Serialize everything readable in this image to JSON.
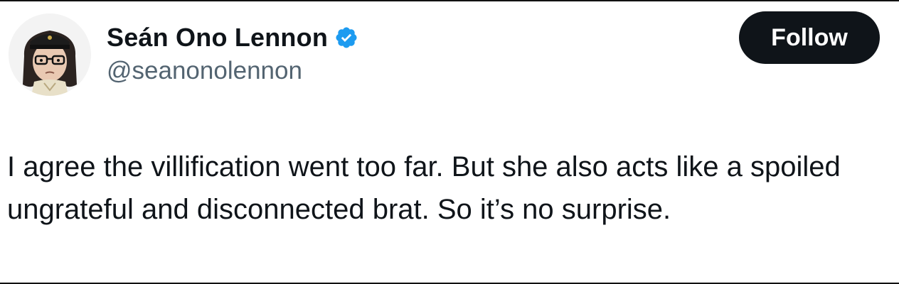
{
  "tweet": {
    "author": {
      "display_name": "Seán Ono Lennon",
      "handle": "@seanonolennon",
      "verified": true,
      "avatar_icon": "cartoon-avatar-with-cap-and-glasses"
    },
    "follow_label": "Follow",
    "text": "I agree the villification went too far. But she also acts like a spoiled ungrateful and disconnected brat. So it’s no surprise."
  },
  "colors": {
    "text": "#0f1419",
    "secondary_text": "#536471",
    "verified_badge": "#1d9bf0",
    "follow_button_bg": "#0f1419",
    "follow_button_text": "#ffffff"
  }
}
